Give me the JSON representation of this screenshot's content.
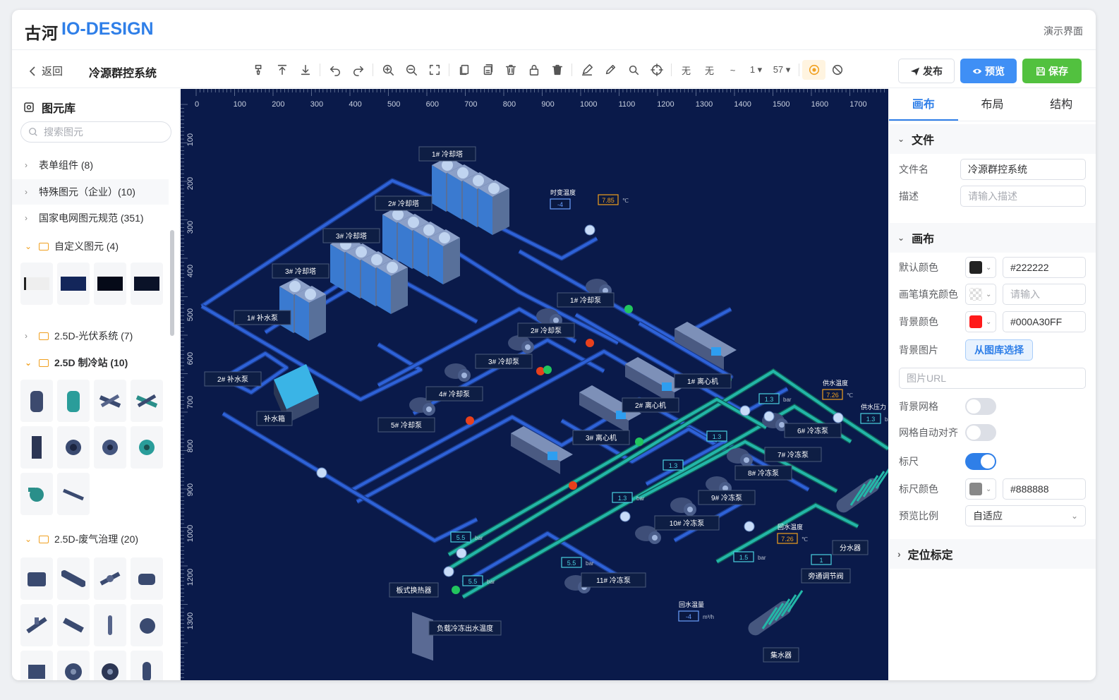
{
  "header": {
    "logo_cn": "古河",
    "logo_en": "IO-DESIGN",
    "demo_label": "演示界面"
  },
  "toolbar": {
    "back_label": "返回",
    "doc_title": "冷源群控系统",
    "text_none_1": "无",
    "text_none_2": "无",
    "line_style": "~",
    "line_width": "1 ▾",
    "zoom": "57 ▾",
    "publish_label": "发布",
    "preview_label": "预览",
    "save_label": "保存"
  },
  "library": {
    "title": "图元库",
    "search_placeholder": "搜索图元",
    "categories": [
      {
        "label": "表单组件 (8)"
      },
      {
        "label": "特殊图元（企业）(10)"
      },
      {
        "label": "国家电网图元规范 (351)"
      },
      {
        "label": "自定义图元 (4)"
      },
      {
        "label": "2.5D-光伏系统 (7)"
      },
      {
        "label": "2.5D 制冷站 (10)"
      },
      {
        "label": "2.5D-废气治理 (20)"
      }
    ]
  },
  "canvas": {
    "ruler_top": [
      "0",
      "100",
      "200",
      "300",
      "400",
      "500",
      "600",
      "700",
      "800",
      "900",
      "1000",
      "1100",
      "1200",
      "1300",
      "1400",
      "1500",
      "1600",
      "1700"
    ],
    "ruler_left": [
      "100",
      "200",
      "300",
      "400",
      "500",
      "600",
      "700",
      "800",
      "900",
      "1000",
      "1200",
      "1300"
    ],
    "labels": {
      "tower1": "1# 冷却塔",
      "tower2": "2# 冷却塔",
      "tower3": "3# 冷却塔",
      "tower4": "3# 冷却塔",
      "makeup_pump1": "1# 补水泵",
      "makeup_pump2": "2# 补水泵",
      "makeup_tank": "补水箱",
      "cool_pump1": "1# 冷却泵",
      "cool_pump2": "2# 冷却泵",
      "cool_pump3": "3# 冷却泵",
      "cool_pump4": "4# 冷却泵",
      "cool_pump5": "5# 冷却泵",
      "chiller1": "1# 离心机",
      "chiller2": "2# 离心机",
      "chiller3": "3# 离心机",
      "freeze6": "6# 冷冻泵",
      "freeze7": "7# 冷冻泵",
      "freeze8": "8# 冷冻泵",
      "freeze9": "9# 冷冻泵",
      "freeze10": "10# 冷冻泵",
      "freeze11": "11# 冷冻泵",
      "plate_hx": "板式换热器",
      "load_temp": "负载冷冻出水温度",
      "return_temp": "回水温度",
      "return_flow": "回水温量",
      "supply_temp": "供水温度",
      "supply_press": "供水压力",
      "distributor": "分水器",
      "collector": "集水器",
      "bypass": "旁通调节阀",
      "time_temp": "时变温度"
    },
    "readouts": {
      "time_temp_val": "-4",
      "temp1": "7.85",
      "temp1_unit": "℃",
      "supply_temp_val": "7.26",
      "supply_temp_unit": "℃",
      "supply_press_val": "1.3",
      "supply_press_unit": "bar",
      "return_temp_val": "7.26",
      "return_temp_unit": "℃",
      "return_flow_val": "-4",
      "return_flow_unit": "m³/h",
      "p1": "1.3",
      "p2": "1.3",
      "p3": "1.3",
      "p4": "1.3",
      "p5": "1.5",
      "p6": "5.5",
      "p7": "5.5",
      "p8": "5.5",
      "bypass_val": "1",
      "bar": "bar"
    }
  },
  "panel": {
    "tabs": [
      "画布",
      "布局",
      "结构"
    ],
    "file_section": "文件",
    "file_name_label": "文件名",
    "file_name_value": "冷源群控系统",
    "desc_label": "描述",
    "desc_placeholder": "请输入描述",
    "canvas_section": "画布",
    "default_color_label": "默认颜色",
    "default_color_value": "#222222",
    "brush_fill_label": "画笔填充颜色",
    "brush_fill_placeholder": "请输入",
    "bg_color_label": "背景颜色",
    "bg_color_value": "#000A30FF",
    "bg_image_label": "背景图片",
    "bg_image_button": "从图库选择",
    "image_url_placeholder": "图片URL",
    "bg_grid_label": "背景网格",
    "grid_snap_label": "网格自动对齐",
    "ruler_label": "标尺",
    "ruler_color_label": "标尺颜色",
    "ruler_color_value": "#888888",
    "preview_ratio_label": "预览比例",
    "preview_ratio_value": "自适应",
    "locate_section": "定位标定"
  }
}
